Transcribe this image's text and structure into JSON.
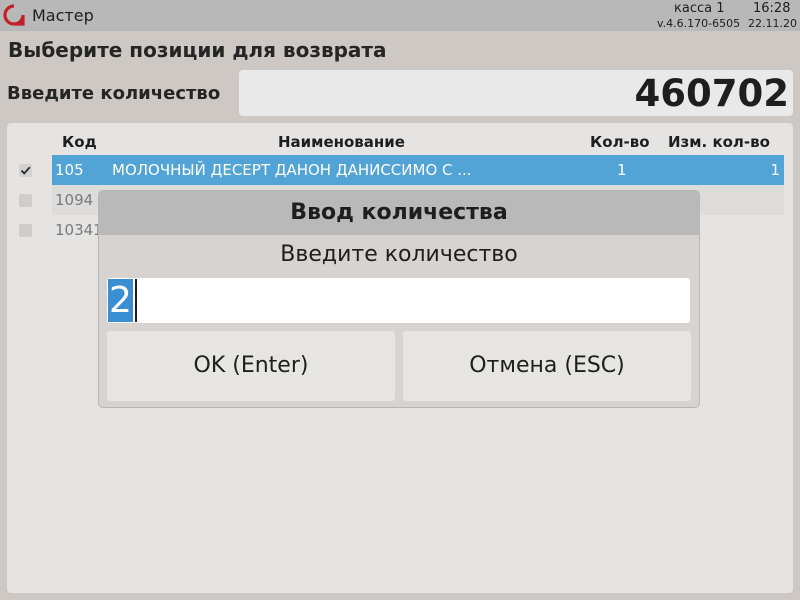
{
  "topbar": {
    "app_title": "Мастер",
    "register": "касса 1",
    "time": "16:28",
    "version": "v.4.6.170-6505",
    "date": "22.11.20"
  },
  "page": {
    "heading": "Выберите позиции для возврата",
    "quantity_label": "Введите количество",
    "barcode_value": "460702"
  },
  "table": {
    "columns": {
      "code": "Код",
      "name": "Наименование",
      "qty": "Кол-во",
      "changed_qty": "Изм. кол-во"
    },
    "rows": [
      {
        "checked": true,
        "code": "105",
        "name": "МОЛОЧНЫЙ ДЕСЕРТ ДАНОН ДАНИССИМО С ...",
        "qty": "1",
        "changed_qty": "1"
      },
      {
        "checked": false,
        "code": "1094",
        "name": "",
        "qty": "",
        "changed_qty": ""
      },
      {
        "checked": false,
        "code": "10341",
        "name": "",
        "qty": "",
        "changed_qty": ""
      }
    ]
  },
  "dialog": {
    "title": "Ввод количества",
    "prompt": "Введите количество",
    "input_value": "2",
    "ok_label": "OK (Enter)",
    "cancel_label": "Отмена (ESC)"
  },
  "colors": {
    "selected_row": "#52a4d7",
    "logo": "#c0202a"
  },
  "icons": {
    "logo": "app-logo-icon",
    "check": "checkmark-icon"
  }
}
